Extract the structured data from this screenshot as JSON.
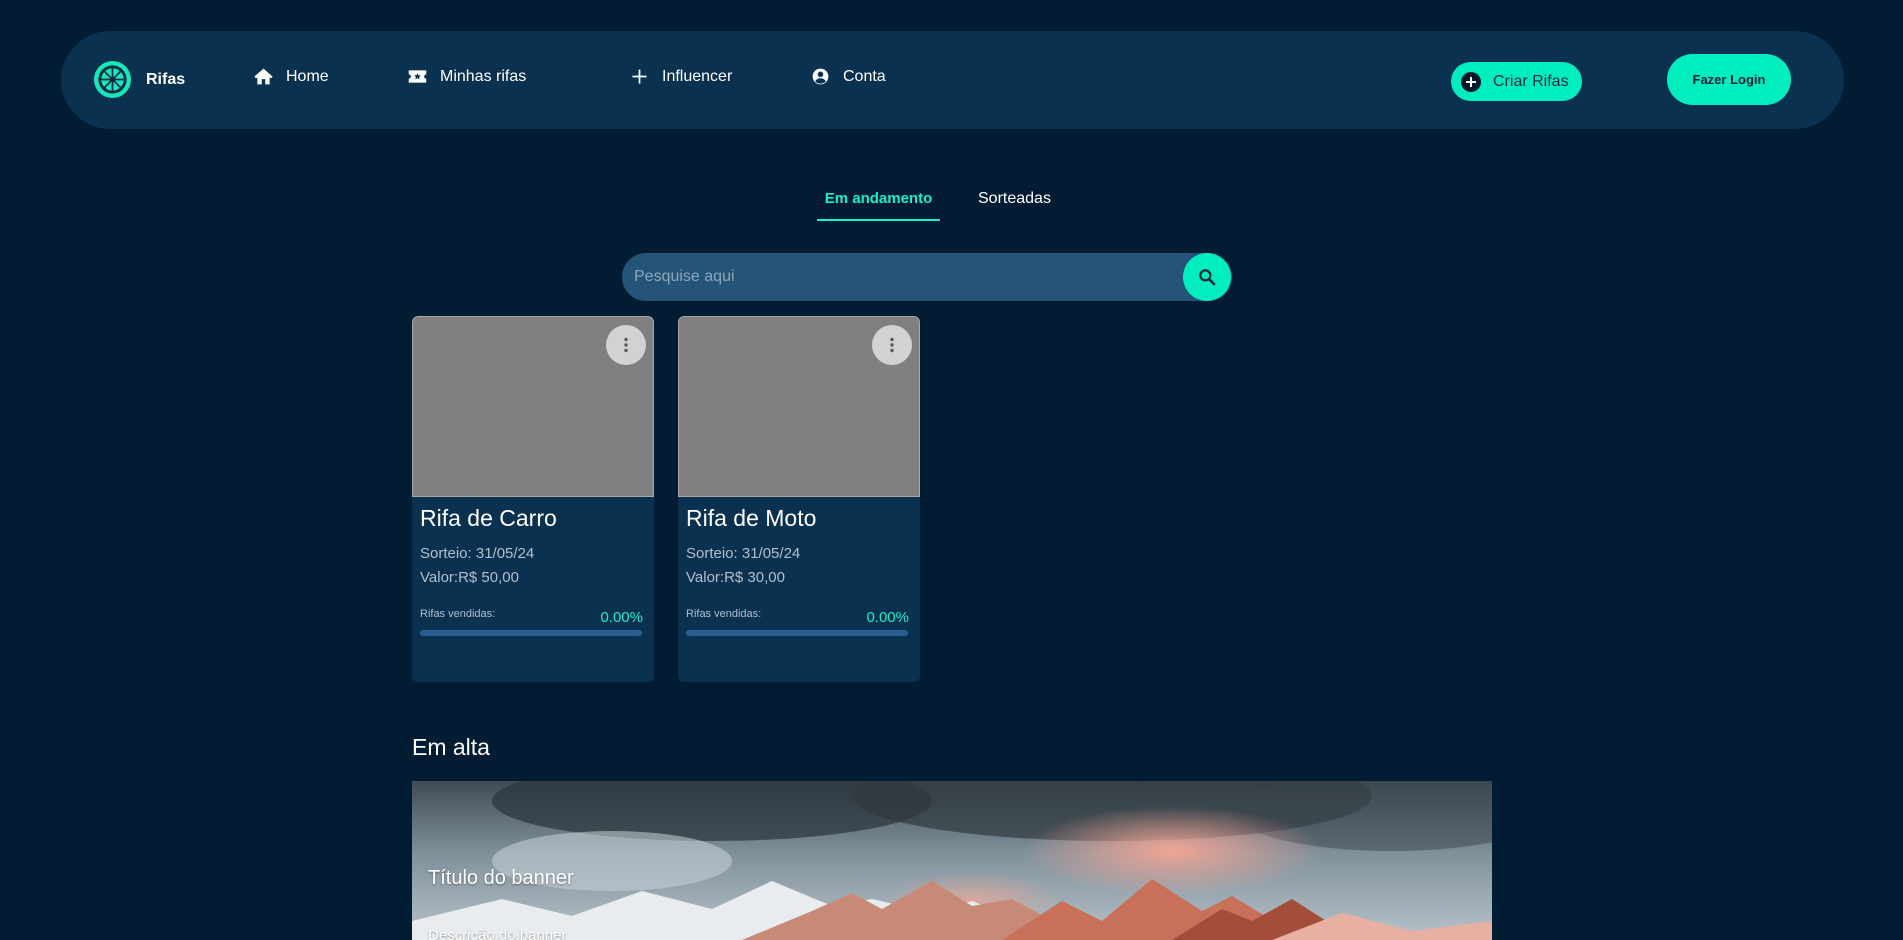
{
  "navbar": {
    "brand": "Rifas",
    "items": [
      {
        "label": "Home",
        "icon": "home-icon"
      },
      {
        "label": "Minhas rifas",
        "icon": "ticket-icon"
      },
      {
        "label": "Influencer",
        "icon": "plus-icon"
      },
      {
        "label": "Conta",
        "icon": "user-circle-icon"
      }
    ],
    "create_label": "Criar Rifas",
    "login_label": "Fazer Login"
  },
  "tabs": [
    {
      "label": "Em andamento",
      "active": true
    },
    {
      "label": "Sorteadas",
      "active": false
    }
  ],
  "search": {
    "placeholder": "Pesquise aqui",
    "value": ""
  },
  "cards": [
    {
      "title": "Rifa de Carro",
      "date": "Sorteio: 31/05/24",
      "price": "Valor:R$ 50,00",
      "sold_label": "Rifas vendidas:",
      "sold_value": "0.00%",
      "progress": 0
    },
    {
      "title": "Rifa de Moto",
      "date": "Sorteio: 31/05/24",
      "price": "Valor:R$ 30,00",
      "sold_label": "Rifas vendidas:",
      "sold_value": "0.00%",
      "progress": 0
    }
  ],
  "featured": {
    "title": "Em alta",
    "banner_title": "Título do banner",
    "banner_description": "Descrição do banner"
  },
  "colors": {
    "background": "#021d33",
    "navbar": "#0b3150",
    "accent": "#00eebe",
    "search_bg": "#255479",
    "card_bg": "#0b3150"
  }
}
